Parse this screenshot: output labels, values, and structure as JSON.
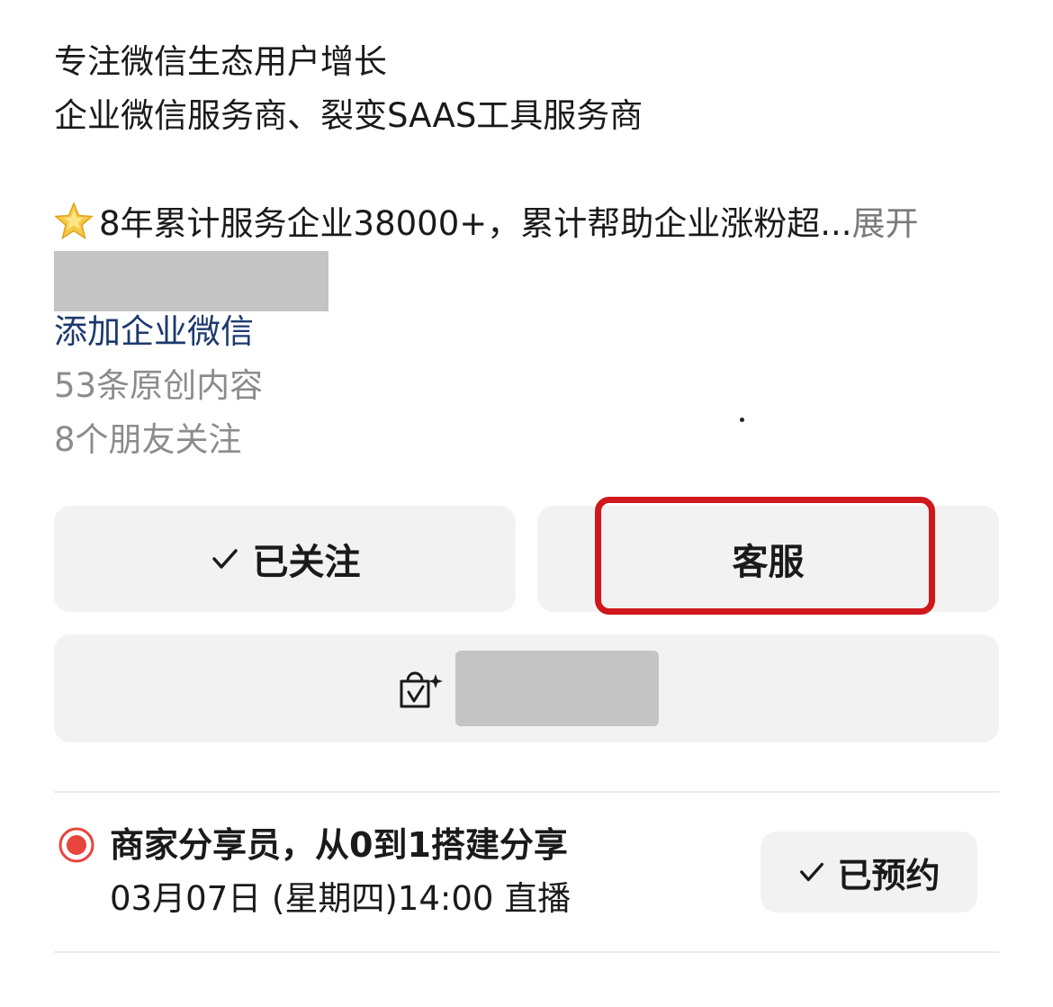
{
  "profile": {
    "intro_line1": "专注微信生态用户增长",
    "intro_line2": "企业微信服务商、裂变SAAS工具服务商",
    "highlight_text": "8年累计服务企业38000+，累计帮助企业涨粉超...",
    "expand_label": "展开",
    "add_wecom_link": "添加企业微信",
    "original_count": "53条原创内容",
    "friends_following": "8个朋友关注"
  },
  "actions": {
    "followed_label": "已关注",
    "customer_service_label": "客服"
  },
  "icons": {
    "star": "star-emoji-icon",
    "check": "check-icon",
    "shop": "shopping-bag-sparkle-icon",
    "live": "live-record-icon"
  },
  "live": {
    "title": "商家分享员，从0到1搭建分享",
    "time": "03月07日 (星期四)14:00 直播",
    "reserved_label": "已预约"
  },
  "colors": {
    "link": "#1d3a6e",
    "highlight_border": "#d0171b",
    "live_red": "#e8453c",
    "button_bg": "#f2f2f2",
    "redaction": "#c4c4c4"
  }
}
